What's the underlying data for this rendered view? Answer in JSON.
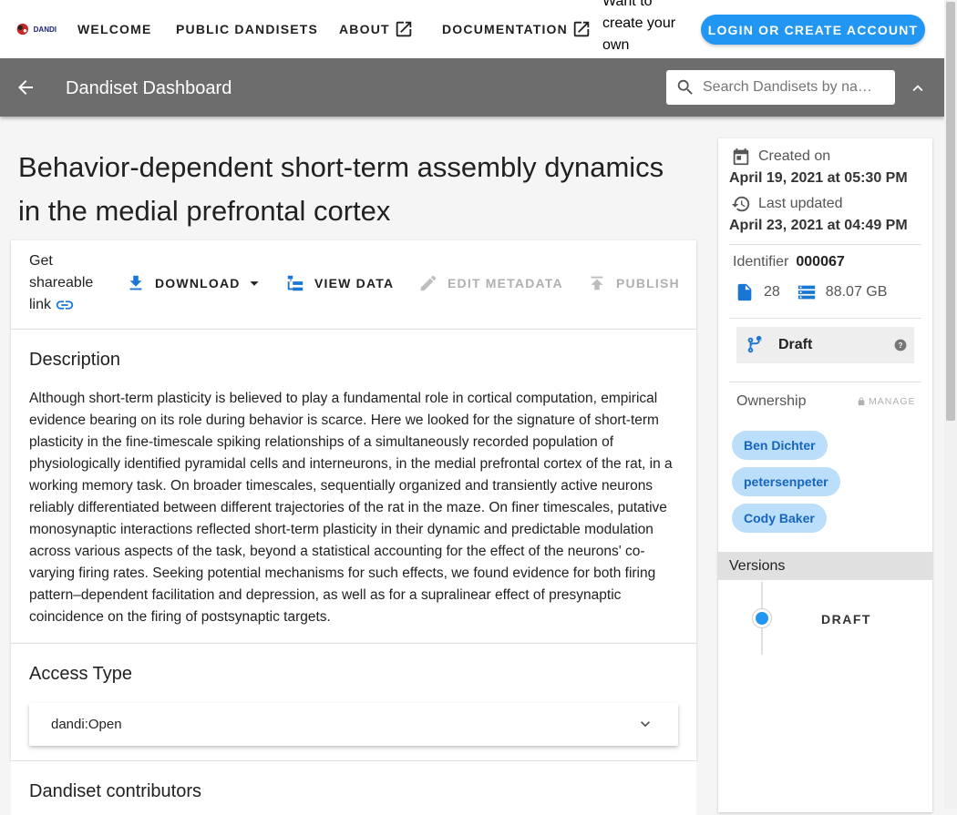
{
  "topbar": {
    "logo_text": "DANDI",
    "nav": [
      {
        "label": "WELCOME"
      },
      {
        "label": "PUBLIC DANDISETS"
      },
      {
        "label": "ABOUT"
      },
      {
        "label": "DOCUMENTATION"
      }
    ],
    "promo_text": "Want to create your own datasets?",
    "login_label": "LOGIN OR CREATE ACCOUNT"
  },
  "subbar": {
    "title": "Dandiset Dashboard",
    "search_placeholder": "Search Dandisets by na…"
  },
  "dandiset": {
    "title": "Behavior-dependent short-term assembly dynamics in the medial prefrontal cortex",
    "actions": {
      "share_label": "Get shareable link",
      "download": "DOWNLOAD",
      "view_data": "VIEW DATA",
      "edit_metadata": "EDIT METADATA",
      "publish": "PUBLISH"
    },
    "description_heading": "Description",
    "description": "Although short-term plasticity is believed to play a fundamental role in cortical computation, empirical evidence bearing on its role during behavior is scarce. Here we looked for the signature of short-term plasticity in the fine-timescale spiking relationships of a simultaneously recorded population of physiologically identified pyramidal cells and interneurons, in the medial prefrontal cortex of the rat, in a working memory task. On broader timescales, sequentially organized and transiently active neurons reliably differentiated between different trajectories of the rat in the maze. On finer timescales, putative monosynaptic interactions reflected short-term plasticity in their dynamic and predictable modulation across various aspects of the task, beyond a statistical accounting for the effect of the neurons' co-varying firing rates. Seeking potential mechanisms for such effects, we found evidence for both firing pattern–dependent facilitation and depression, as well as for a supralinear effect of presynaptic coincidence on the firing of postsynaptic targets.",
    "access_heading": "Access Type",
    "access_value": "dandi:Open",
    "contributors_heading": "Dandiset contributors"
  },
  "sidebar": {
    "created_label": "Created on",
    "created_value": "April 19, 2021 at 05:30 PM",
    "updated_label": "Last updated",
    "updated_value": "April 23, 2021 at 04:49 PM",
    "identifier_label": "Identifier",
    "identifier_value": "000067",
    "file_count": "28",
    "size": "88.07 GB",
    "version_status": "Draft",
    "ownership_label": "Ownership",
    "manage_label": "MANAGE",
    "owners": [
      "Ben Dichter",
      "petersenpeter",
      "Cody Baker"
    ],
    "versions_heading": "Versions",
    "versions": [
      {
        "label": "DRAFT"
      }
    ]
  },
  "colors": {
    "accent": "#2196f3",
    "subbar": "#6d6d6d",
    "chip_bg": "#bbdefb",
    "chip_text": "#1565c0"
  }
}
